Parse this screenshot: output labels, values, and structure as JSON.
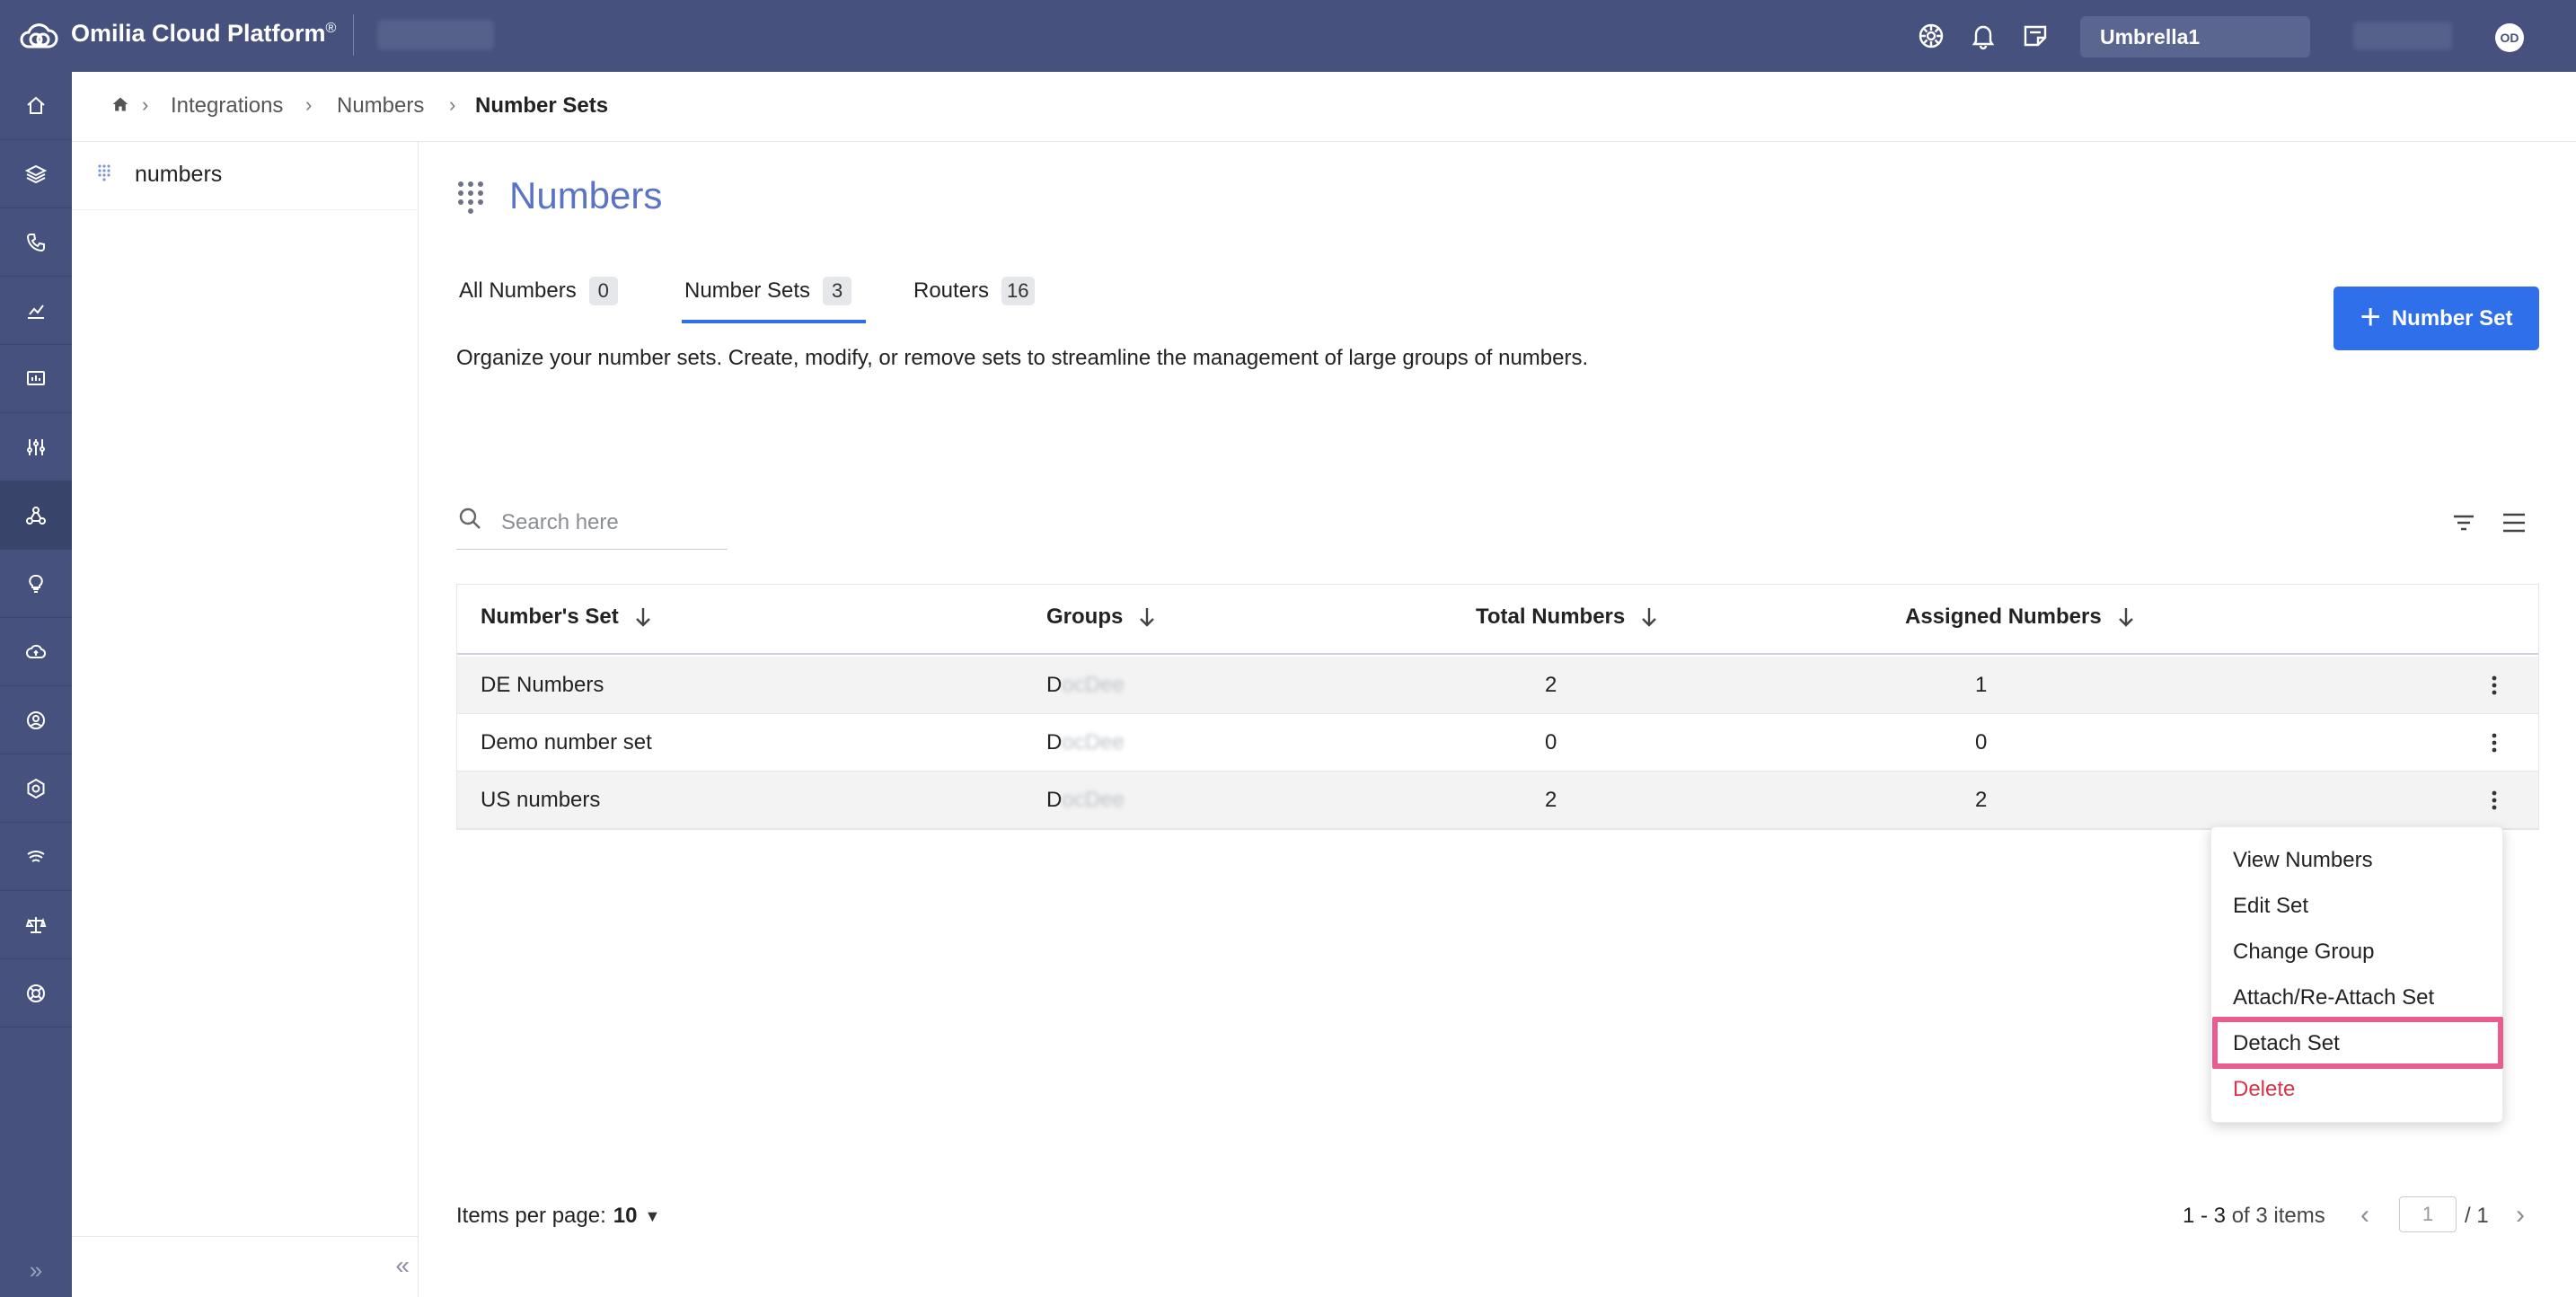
{
  "app": {
    "name": "Omilia Cloud Platform",
    "trademark": "®",
    "tenant": "Umbrella1",
    "user_initials": "OD"
  },
  "icons": {
    "logo": "cloud-logo-icon",
    "top": [
      "dial-icon",
      "bell-icon",
      "notes-icon"
    ],
    "rail": [
      "home-icon",
      "layers-icon",
      "phone-icon",
      "analytics-icon",
      "dashboard-icon",
      "sliders-icon",
      "integrations-icon",
      "lightbulb-icon",
      "cloud-upload-icon",
      "support-icon",
      "settings-icon",
      "speech-icon",
      "balance-icon",
      "help-icon"
    ]
  },
  "breadcrumb": {
    "items": [
      "Integrations",
      "Numbers",
      "Number Sets"
    ]
  },
  "sidepanel": {
    "item_label": "numbers"
  },
  "page": {
    "title": "Numbers",
    "description": "Organize your number sets. Create, modify, or remove sets to streamline the management of large groups of numbers.",
    "add_button": "Number Set"
  },
  "tabs": [
    {
      "label": "All Numbers",
      "count": "0"
    },
    {
      "label": "Number Sets",
      "count": "3"
    },
    {
      "label": "Routers",
      "count": "16"
    }
  ],
  "search": {
    "placeholder": "Search here"
  },
  "table": {
    "columns": [
      "Number's Set",
      "Groups",
      "Total Numbers",
      "Assigned Numbers"
    ],
    "rows": [
      {
        "set": "DE Numbers",
        "group_initial": "D",
        "group_rest": "ocDee",
        "total": "2",
        "assigned": "1"
      },
      {
        "set": "Demo number set",
        "group_initial": "D",
        "group_rest": "ocDee",
        "total": "0",
        "assigned": "0"
      },
      {
        "set": "US numbers",
        "group_initial": "D",
        "group_rest": "ocDee",
        "total": "2",
        "assigned": "2"
      }
    ]
  },
  "context_menu": {
    "items": [
      "View Numbers",
      "Edit Set",
      "Change Group",
      "Attach/Re-Attach Set",
      "Detach Set",
      "Delete"
    ],
    "highlighted": "Detach Set",
    "highlight_color": "#e85c8f",
    "danger_color": "#d6344a"
  },
  "pagination": {
    "items_per_page_label": "Items per page:",
    "items_per_page": "10",
    "range": "1 - 3",
    "of_label": "of 3 items",
    "current_page": "1",
    "total_pages": "/ 1"
  },
  "colors": {
    "brand": "#46527d",
    "accent": "#2f6fea",
    "title": "#5b73c4"
  }
}
